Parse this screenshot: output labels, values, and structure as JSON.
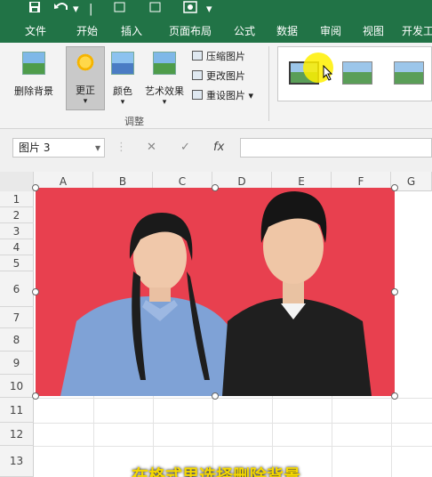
{
  "quick_access": {
    "save_icon": "save-icon",
    "undo_icon": "undo-icon"
  },
  "tabs": [
    "文件",
    "开始",
    "插入",
    "页面布局",
    "公式",
    "数据",
    "审阅",
    "视图",
    "开发工"
  ],
  "ribbon": {
    "remove_bg": "删除背景",
    "corrections": "更正",
    "color": "颜色",
    "artistic": "艺术效果",
    "compress": "压缩图片",
    "change": "更改图片",
    "reset": "重设图片",
    "group_label": "调整"
  },
  "name_box": "图片 3",
  "formula_icons": {
    "cancel": "✕",
    "enter": "✓",
    "fx": "fx"
  },
  "columns": [
    "A",
    "B",
    "C",
    "D",
    "E",
    "F",
    "G"
  ],
  "rows": [
    "1",
    "2",
    "3",
    "4",
    "5",
    "6",
    "7",
    "8",
    "9",
    "10",
    "11",
    "12",
    "13"
  ],
  "subtitle": "在格式里选择删除背景",
  "colors": {
    "excel_green": "#217346",
    "picture_bg": "#e8404f",
    "subtitle": "#f5d800"
  }
}
